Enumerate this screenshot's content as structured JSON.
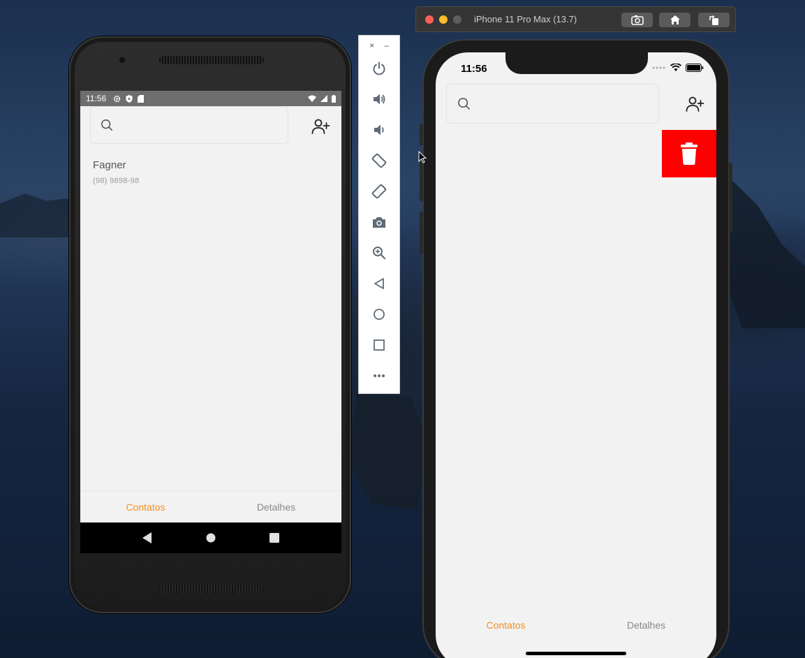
{
  "android": {
    "status": {
      "time": "11:56"
    },
    "search": {
      "placeholder": ""
    },
    "contacts": [
      {
        "name": "Fagner",
        "phone": "(98) 9898-98"
      }
    ],
    "tabs": [
      {
        "label": "Contatos",
        "active": true
      },
      {
        "label": "Detalhes",
        "active": false
      }
    ],
    "nav_icons": [
      "back-triangle-icon",
      "home-circle-icon",
      "recents-square-icon"
    ]
  },
  "emulator_toolbar": {
    "close_label": "×",
    "minimize_label": "–",
    "icons": [
      "power-icon",
      "volume-up-icon",
      "volume-down-icon",
      "rotate-left-icon",
      "rotate-right-icon",
      "camera-icon",
      "zoom-icon",
      "back-icon",
      "home-icon",
      "overview-icon",
      "more-icon"
    ]
  },
  "simulator": {
    "title": "iPhone 11 Pro Max (13.7)",
    "buttons": [
      "screenshot-icon",
      "home-icon",
      "rotate-icon"
    ]
  },
  "ios": {
    "status": {
      "time": "11:56"
    },
    "search": {
      "placeholder": ""
    },
    "tabs": [
      {
        "label": "Contatos",
        "active": true
      },
      {
        "label": "Detalhes",
        "active": false
      }
    ]
  },
  "colors": {
    "active_tab": "#f5901e",
    "inactive_tab": "#888888",
    "delete": "#ff0000",
    "screen_bg": "#f2f2f2"
  }
}
